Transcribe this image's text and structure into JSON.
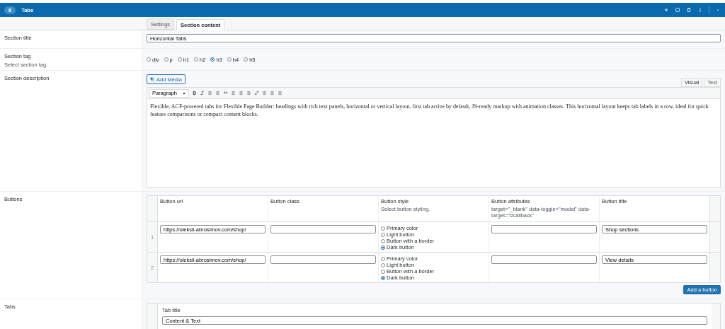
{
  "header": {
    "badge": "6",
    "title": "Tabs"
  },
  "tabs": [
    {
      "label": "Settings",
      "selected": false
    },
    {
      "label": "Section content",
      "selected": true
    }
  ],
  "section_title": {
    "label": "Section title",
    "value": "Horizontal Tabs"
  },
  "section_tag": {
    "label": "Section tag",
    "hint": "Select section tag.",
    "options": [
      {
        "label": "div",
        "selected": false
      },
      {
        "label": "p",
        "selected": false
      },
      {
        "label": "h1",
        "selected": false
      },
      {
        "label": "h2",
        "selected": false
      },
      {
        "label": "h3",
        "selected": true
      },
      {
        "label": "h4",
        "selected": false
      },
      {
        "label": "h5",
        "selected": false
      }
    ]
  },
  "section_description": {
    "label": "Section description",
    "add_media": "Add Media",
    "modes": [
      {
        "label": "Visual",
        "selected": true
      },
      {
        "label": "Text",
        "selected": false
      }
    ],
    "format": "Paragraph",
    "text": "Flexible, ACF-powered tabs for Flexible Page Builder: headings with rich text panels, horizontal or vertical layout, first tab active by default, JS-ready markup with animation classes. This horizontal layout keeps tab labels in a row, ideal for quick feature comparisons or compact content blocks."
  },
  "buttons": {
    "label": "Buttons",
    "columns": [
      {
        "label": "Button url"
      },
      {
        "label": "Button class"
      },
      {
        "label": "Button style",
        "hint": "Select button styling."
      },
      {
        "label": "Button attributes",
        "hint": "target=\"_blank\" data-toggle=\"modal\" data-target=\"#callback\""
      },
      {
        "label": "Button title"
      }
    ],
    "rows": [
      {
        "index": "1",
        "url": "https://oleksii-abrosimov.com/shop/",
        "styles": [
          {
            "label": "Primary color",
            "selected": false
          },
          {
            "label": "Light button",
            "selected": false
          },
          {
            "label": "Button with a border",
            "selected": false
          },
          {
            "label": "Dark button",
            "selected": true
          }
        ],
        "title": "Shop sections"
      },
      {
        "index": "2",
        "url": "https://oleksii-abrosimov.com/shop/",
        "styles": [
          {
            "label": "Primary color",
            "selected": false
          },
          {
            "label": "Light button",
            "selected": false
          },
          {
            "label": "Button with a border",
            "selected": false
          },
          {
            "label": "Dark button",
            "selected": true
          }
        ],
        "title": "View details"
      }
    ],
    "add_button": "Add a button"
  },
  "tabs_field": {
    "label": "Tabs",
    "tab_title_label": "Tab title",
    "tab_title": "Content & Text"
  }
}
